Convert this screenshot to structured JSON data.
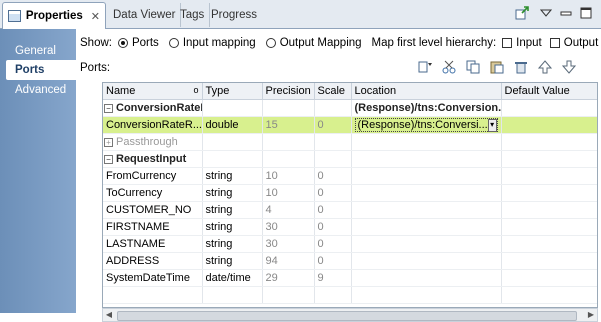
{
  "tabs": [
    {
      "label": "Properties",
      "active": true,
      "close": "✕"
    },
    {
      "label": "Data Viewer"
    },
    {
      "label": "Tags"
    },
    {
      "label": "Progress"
    }
  ],
  "sidebar": {
    "items": [
      {
        "label": "General"
      },
      {
        "label": "Ports",
        "active": true
      },
      {
        "label": "Advanced"
      }
    ]
  },
  "show": {
    "label": "Show:",
    "ports": "Ports",
    "input_mapping": "Input mapping",
    "output_mapping": "Output Mapping",
    "map_hierarchy": "Map first level hierarchy:",
    "input": "Input",
    "output": "Output"
  },
  "ports_label": "Ports:",
  "table": {
    "columns": [
      "Name",
      "Type",
      "Precision",
      "Scale",
      "Location",
      "Default Value"
    ],
    "rows": [
      {
        "kind": "group",
        "expander": "−",
        "name": "ConversionRateResponse",
        "type": "",
        "precision": "",
        "scale": "",
        "location": "(Response)/tns:Conversion...",
        "default": ""
      },
      {
        "kind": "selected",
        "name": "ConversionRateR...",
        "type": "double",
        "precision": "15",
        "scale": "0",
        "location": "(Response)/tns:Conversi...",
        "default": ""
      },
      {
        "kind": "pass",
        "expander": "+",
        "name": "Passthrough",
        "type": "",
        "precision": "",
        "scale": "",
        "location": "",
        "default": ""
      },
      {
        "kind": "group",
        "expander": "−",
        "name": "RequestInput",
        "type": "",
        "precision": "",
        "scale": "",
        "location": "",
        "default": ""
      },
      {
        "kind": "row",
        "name": "FromCurrency",
        "type": "string",
        "precision": "10",
        "scale": "0",
        "location": "",
        "default": ""
      },
      {
        "kind": "row",
        "name": "ToCurrency",
        "type": "string",
        "precision": "10",
        "scale": "0",
        "location": "",
        "default": ""
      },
      {
        "kind": "row",
        "name": "CUSTOMER_NO",
        "type": "string",
        "precision": "4",
        "scale": "0",
        "location": "",
        "default": ""
      },
      {
        "kind": "row",
        "name": "FIRSTNAME",
        "type": "string",
        "precision": "30",
        "scale": "0",
        "location": "",
        "default": ""
      },
      {
        "kind": "row",
        "name": "LASTNAME",
        "type": "string",
        "precision": "30",
        "scale": "0",
        "location": "",
        "default": ""
      },
      {
        "kind": "row",
        "name": "ADDRESS",
        "type": "string",
        "precision": "94",
        "scale": "0",
        "location": "",
        "default": ""
      },
      {
        "kind": "row",
        "name": "SystemDateTime",
        "type": "date/time",
        "precision": "29",
        "scale": "9",
        "location": "",
        "default": ""
      }
    ]
  },
  "colors": {
    "accent": "#d8f08e",
    "sidebar": "#7b9cc3"
  }
}
